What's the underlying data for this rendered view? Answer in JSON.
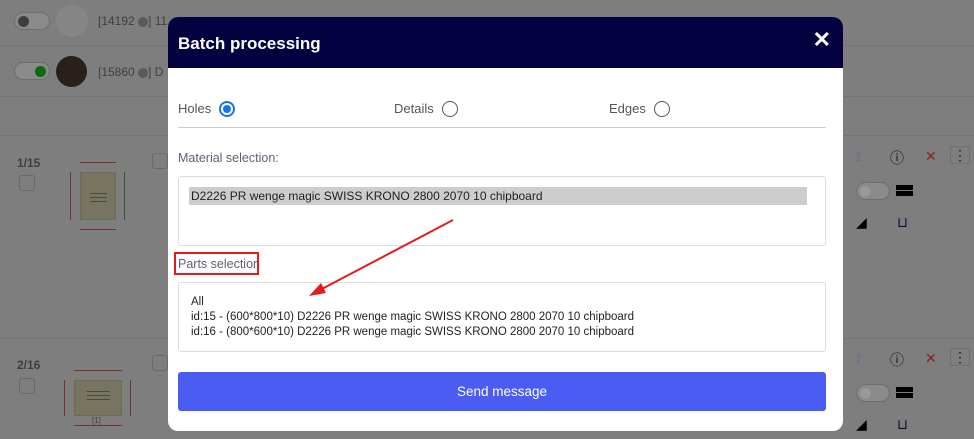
{
  "background": {
    "rows": [
      {
        "id_text": "[14192",
        "suffix": "] 11"
      },
      {
        "id_text": "[15860",
        "suffix": "] D"
      }
    ],
    "parts": [
      {
        "index": "1/15"
      },
      {
        "index": "2/16",
        "thumb_label": "[1]"
      }
    ]
  },
  "modal": {
    "title": "Batch processing",
    "options": [
      {
        "label": "Holes",
        "selected": true
      },
      {
        "label": "Details",
        "selected": false
      },
      {
        "label": "Edges",
        "selected": false
      }
    ],
    "material_label": "Material selection:",
    "material_selected": "D2226 PR wenge magic SWISS KRONO 2800 2070 10 chipboard",
    "parts_label": "Parts selection",
    "parts": [
      "All",
      "id:15 - (600*800*10) D2226 PR wenge magic SWISS KRONO 2800 2070 10 chipboard",
      "id:16 - (800*600*10) D2226 PR wenge magic SWISS KRONO 2800 2070 10 chipboard"
    ],
    "send_label": "Send message"
  },
  "colors": {
    "header": "#03013f",
    "accent": "#4a5cf2",
    "annotation": "#e31b1b"
  }
}
